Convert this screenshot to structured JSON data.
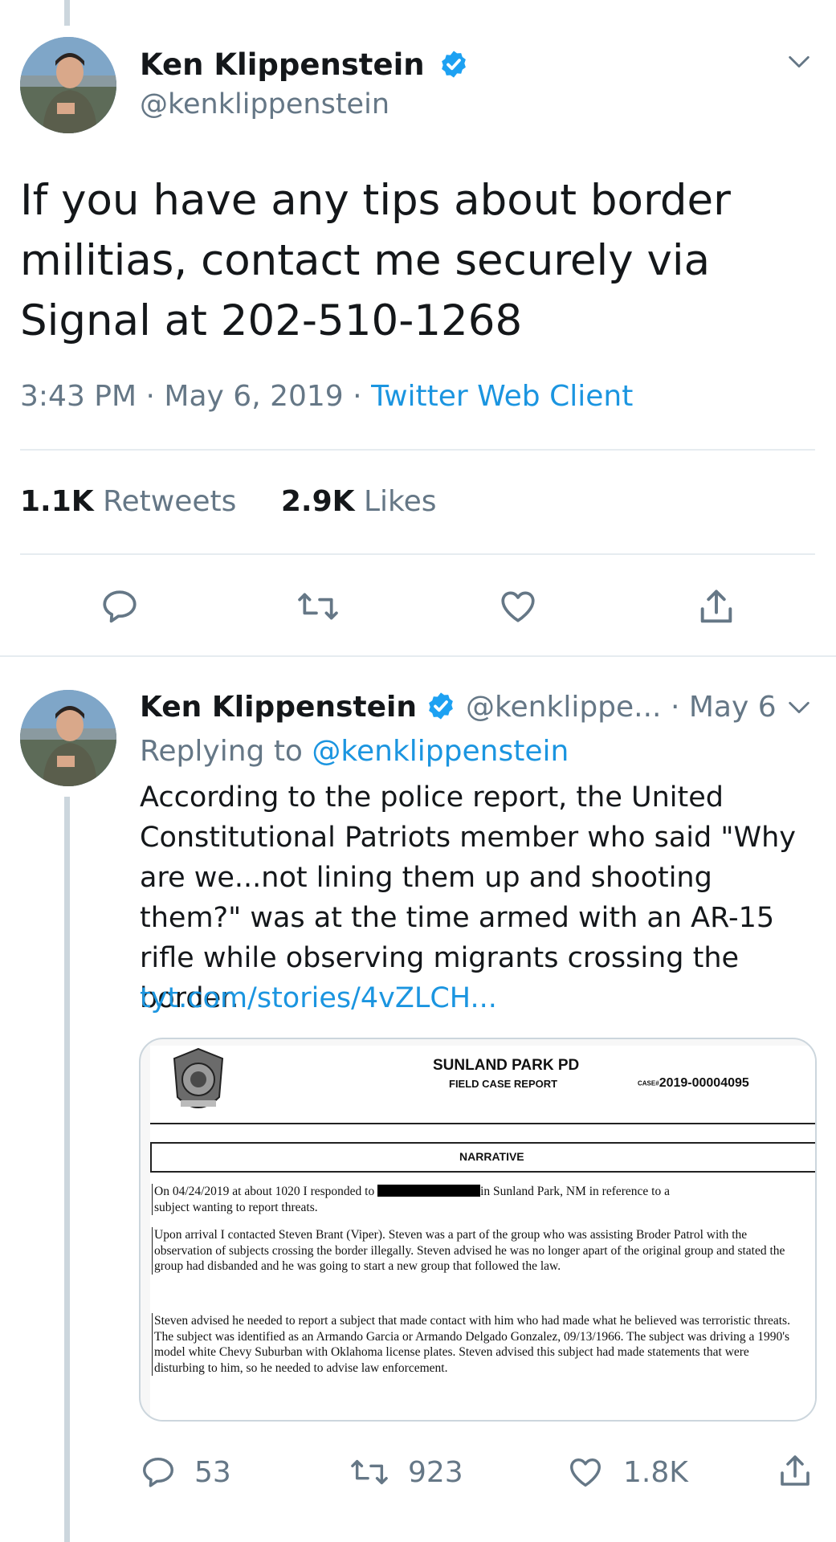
{
  "colors": {
    "accent": "#1b95e0",
    "muted": "#657786",
    "text": "#14171a",
    "verified": "#1da1f2"
  },
  "main_tweet": {
    "author_name": "Ken Klippenstein",
    "author_handle": "@kenklippenstein",
    "text": "If you have any tips about border militias, contact me securely via Signal at 202-510-1268",
    "time": "3:43 PM",
    "separator1": "·",
    "date": "May 6, 2019",
    "separator2": "·",
    "source": "Twitter Web Client",
    "retweets_count": "1.1K",
    "retweets_label": "Retweets",
    "likes_count": "2.9K",
    "likes_label": "Likes",
    "icons": [
      "reply-icon",
      "retweet-icon",
      "like-icon",
      "share-icon",
      "chevron-down-icon",
      "verified-icon"
    ]
  },
  "reply_tweet": {
    "author_name": "Ken Klippenstein",
    "author_handle": "@kenklippe...",
    "separator": "·",
    "date": "May 6",
    "replying_prefix": "Replying to",
    "replying_handle": "@kenklippenstein",
    "text": "According to the police report, the United Constitutional Patriots member who said \"Why are we...not lining them up and shooting them?\" was at the time armed with an AR-15 rifle while observing migrants crossing the border.",
    "link": "tyt.com/stories/4vZLCH...",
    "reply_count": "53",
    "retweet_count": "923",
    "like_count": "1.8K"
  },
  "report_image": {
    "department": "SUNLAND PARK PD",
    "form_title": "FIELD CASE REPORT",
    "case_label": "CASE#",
    "case_number": "2019-00004095",
    "section_title": "NARRATIVE",
    "para1_start": "On 04/24/2019 at about 1020 I responded to",
    "para1_end": "in Sunland Park, NM in reference to a",
    "para1_line2": "subject wanting to report threats.",
    "para2": "Upon arrival I contacted Steven Brant (Viper). Steven was a part of the group who was assisting Broder Patrol with the observation of subjects crossing the border illegally. Steven advised he was no longer apart of the original group and stated the group had disbanded and he was going to start a new group that followed the law.",
    "para3": "Steven advised he needed to report a subject that made contact with him who had made what he believed was terroristic threats. The subject was identified as an Armando Garcia or Armando Delgado Gonzalez, 09/13/1966. The subject was driving a 1990's model white Chevy Suburban with Oklahoma license plates. Steven advised this subject had made statements that were disturbing to him, so he needed to advise law enforcement."
  }
}
